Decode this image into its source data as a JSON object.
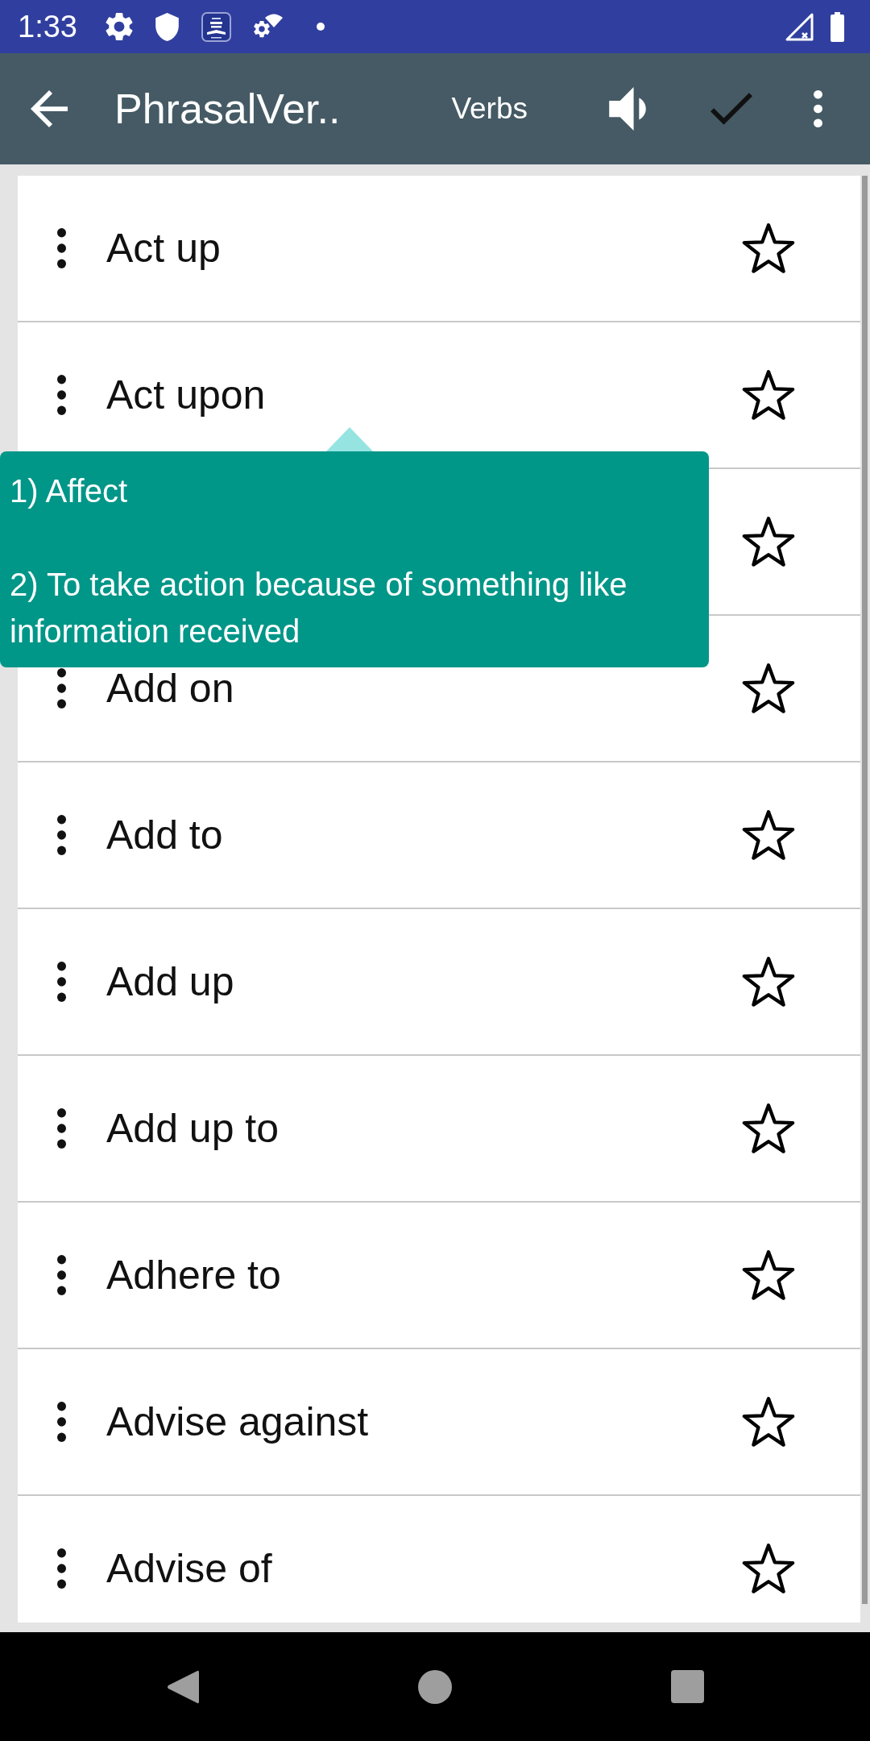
{
  "status_bar": {
    "time": "1:33"
  },
  "toolbar": {
    "title": "PhrasalVer..",
    "filter_label": "Verbs"
  },
  "list": {
    "rows": [
      {
        "label": "Act up",
        "starred": false
      },
      {
        "label": "Act upon",
        "starred": false,
        "tooltip": {
          "definitions": [
            "1) Affect",
            "2) To take action because of something like information received"
          ]
        }
      },
      {
        "starred": false
      },
      {
        "label": "Add on",
        "starred": false
      },
      {
        "label": "Add to",
        "starred": false
      },
      {
        "label": "Add up",
        "starred": false
      },
      {
        "label": "Add up to",
        "starred": false
      },
      {
        "label": "Adhere to",
        "starred": false
      },
      {
        "label": "Advise against",
        "starred": false
      },
      {
        "label": "Advise of",
        "starred": false
      }
    ]
  }
}
